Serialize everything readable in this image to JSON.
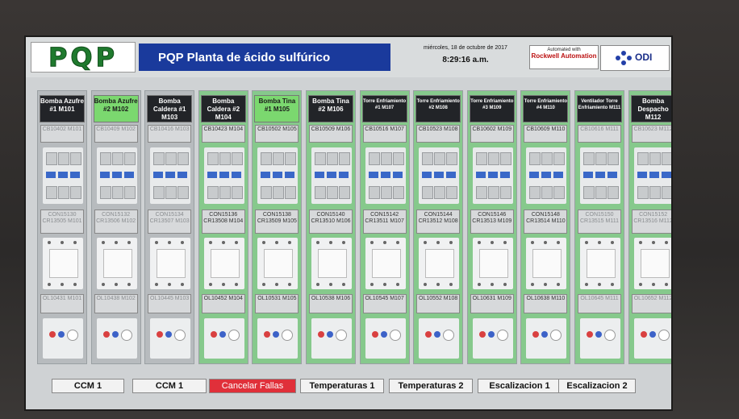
{
  "header": {
    "logo": "PQP",
    "title": "PQP Planta de ácido sulfúrico",
    "date": "miércoles, 18 de octubre de 2017",
    "time": "8:29:16 a.m.",
    "rockwell_top": "Automated with",
    "rockwell_brand": "Rockwell Automation",
    "odi": "ODI"
  },
  "columns": [
    {
      "label": "Bomba Azufre #1 M101",
      "cb": "CB10402 M101",
      "con": "CON15130 CR13505 M101",
      "ol": "OL10431 M101",
      "active": false,
      "small": false,
      "faded": true
    },
    {
      "label": "Bomba Azufre #2 M102",
      "cb": "CB10409 M102",
      "con": "CON15132 CR13506 M102",
      "ol": "OL10438 M102",
      "active": true,
      "small": false,
      "faded": true
    },
    {
      "label": "Bomba Caldera #1 M103",
      "cb": "CB10416 M103",
      "con": "CON15134 CR13507 M103",
      "ol": "OL10445 M103",
      "active": false,
      "small": false,
      "faded": true
    },
    {
      "label": "Bomba Caldera #2 M104",
      "cb": "CB10423 M104",
      "con": "CON15136 CR13508 M104",
      "ol": "OL10452 M104",
      "active": false,
      "small": false,
      "faded": false
    },
    {
      "label": "Bomba Tina #1 M105",
      "cb": "CB10502 M105",
      "con": "CON15138 CR13509 M105",
      "ol": "OL10531 M105",
      "active": true,
      "small": false,
      "faded": false
    },
    {
      "label": "Bomba Tina #2 M106",
      "cb": "CB10509 M106",
      "con": "CON15140 CR13510 M106",
      "ol": "OL10538 M106",
      "active": false,
      "small": false,
      "faded": false
    },
    {
      "label": "Torre Enfriamiento #1 M107",
      "cb": "CB10516 M107",
      "con": "CON15142 CR13511 M107",
      "ol": "OL10545 M107",
      "active": false,
      "small": true,
      "faded": false
    },
    {
      "label": "Torre Enfriamiento #2 M108",
      "cb": "CB10523 M108",
      "con": "CON15144 CR13512 M108",
      "ol": "OL10552 M108",
      "active": false,
      "small": true,
      "faded": false
    },
    {
      "label": "Torre Enfriamiento #3 M109",
      "cb": "CB10602 M109",
      "con": "CON15146 CR13513 M109",
      "ol": "OL10631 M109",
      "active": false,
      "small": true,
      "faded": false
    },
    {
      "label": "Torre Enfriamiento #4 M110",
      "cb": "CB10609 M110",
      "con": "CON15148 CR13514 M110",
      "ol": "OL10638 M110",
      "active": false,
      "small": true,
      "faded": false
    },
    {
      "label": "Ventilador Torre Enfriamiento M111",
      "cb": "CB10616 M111",
      "con": "CON15150 CR13515 M111",
      "ol": "OL10645 M111",
      "active": false,
      "small": true,
      "faded": true
    },
    {
      "label": "Bomba Despacho M112",
      "cb": "CB10623 M112",
      "con": "CON15152 CR13516 M112",
      "ol": "OL10652 M112",
      "active": false,
      "small": false,
      "faded": true
    }
  ],
  "tabs": [
    "CCM 1",
    "CCM 1",
    "Cancelar Fallas",
    "Temperaturas 1",
    "Temperaturas 2",
    "Escalizacion 1",
    "Escalizacion 2"
  ],
  "colors": {
    "active": "#7bd86f",
    "alarm": "#e0303a",
    "title_bg": "#1a3a9c"
  }
}
